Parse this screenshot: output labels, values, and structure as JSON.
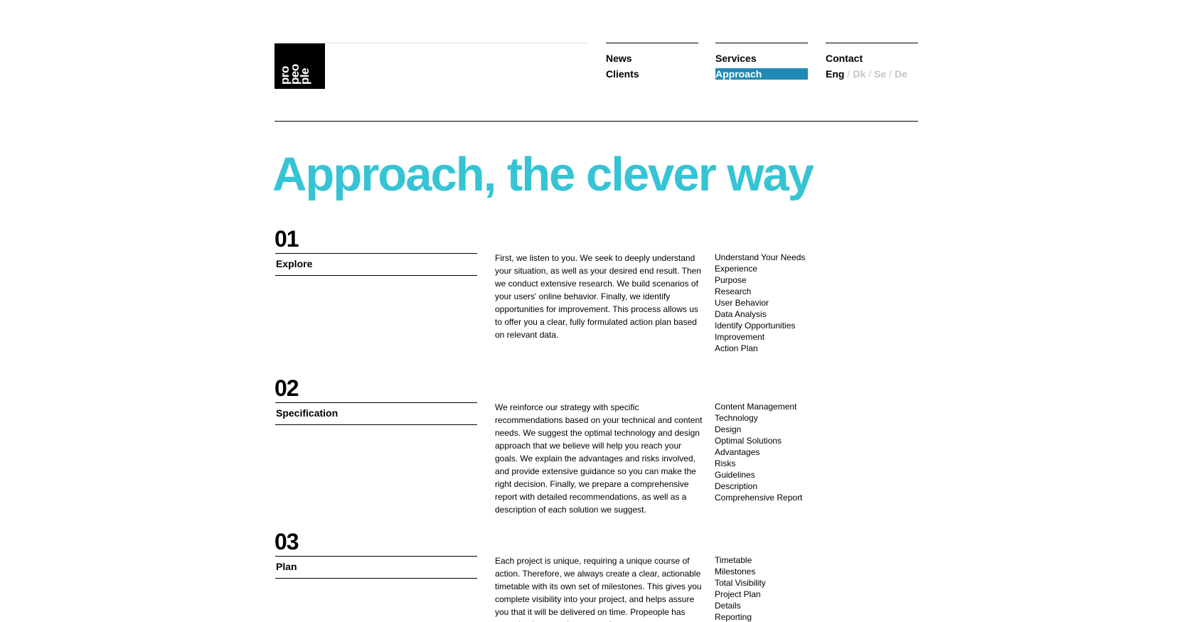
{
  "logo": {
    "lines": [
      "pro",
      "peo",
      "ple"
    ]
  },
  "nav": {
    "col1": [
      "News",
      "Clients"
    ],
    "col2": [
      "Services",
      "Approach"
    ],
    "col3_title": "Contact",
    "active_item": "Approach",
    "languages": {
      "current": "Eng",
      "separator": "/",
      "others": [
        "Dk",
        "Se",
        "De"
      ]
    }
  },
  "page_title": "Approach, the clever way",
  "colors": {
    "title": "#36c4d4",
    "active_nav_bg": "#1f8ab5",
    "inactive_lang": "#c4c4c4"
  },
  "steps": [
    {
      "number": "01",
      "label": "Explore",
      "description": "First, we listen to you. We seek to deeply understand your situation, as well as your desired end result. Then we conduct extensive research. We build scenarios of your users' online behavior. Finally, we identify opportunities for improvement. This process allows us to offer you a clear, fully formulated action plan based on relevant data.",
      "keywords": [
        "Understand Your Needs",
        "Experience",
        "Purpose",
        "Research",
        "User Behavior",
        "Data Analysis",
        "Identify Opportunities",
        "Improvement",
        "Action Plan"
      ]
    },
    {
      "number": "02",
      "label": "Specification",
      "description": "We reinforce our strategy with specific recommendations based on your technical and content needs. We suggest the optimal technology and design approach that we believe will help you reach your goals. We explain the advantages and risks involved, and provide extensive guidance so you can make the right decision. Finally, we prepare a comprehensive report with detailed recommendations, as well as a description of each solution we suggest.",
      "keywords": [
        "Content Management",
        "Technology",
        "Design",
        "Optimal Solutions",
        "Advantages",
        "Risks",
        "Guidelines",
        "Description",
        "Comprehensive Report"
      ]
    },
    {
      "number": "03",
      "label": "Plan",
      "description": "Each project is unique, requiring a unique course of action. Therefore, we always create a clear, actionable timetable with its own set of milestones. This gives you complete visibility into your project, and helps assure you that it will be delivered on time. Propeople has expertise in managing some of",
      "keywords": [
        "Timetable",
        "Milestones",
        "Total Visibility",
        "Project Plan",
        "Details",
        "Reporting"
      ]
    }
  ]
}
